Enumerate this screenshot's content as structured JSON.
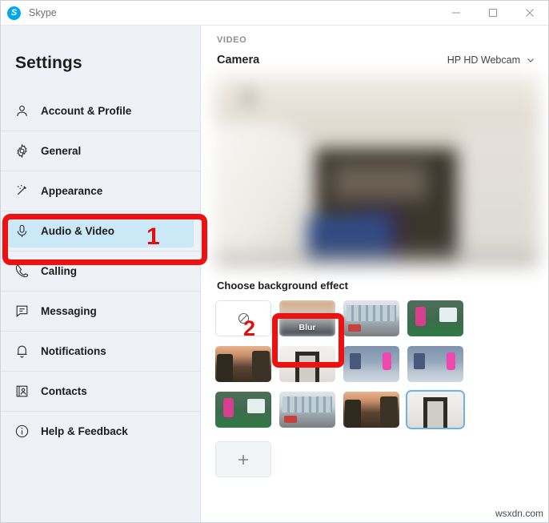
{
  "titlebar": {
    "app_name": "Skype",
    "logo_letter": "S",
    "minimize_label": "minimize-icon",
    "maximize_label": "maximize-icon",
    "close_label": "close-icon"
  },
  "sidebar": {
    "heading": "Settings",
    "items": [
      {
        "label": "Account & Profile",
        "icon": "person-icon",
        "selected": false
      },
      {
        "label": "General",
        "icon": "gear-icon",
        "selected": false
      },
      {
        "label": "Appearance",
        "icon": "magic-wand-icon",
        "selected": false
      },
      {
        "label": "Audio & Video",
        "icon": "microphone-icon",
        "selected": true
      },
      {
        "label": "Calling",
        "icon": "phone-icon",
        "selected": false
      },
      {
        "label": "Messaging",
        "icon": "chat-bubble-icon",
        "selected": false
      },
      {
        "label": "Notifications",
        "icon": "bell-icon",
        "selected": false
      },
      {
        "label": "Contacts",
        "icon": "contact-card-icon",
        "selected": false
      },
      {
        "label": "Help & Feedback",
        "icon": "info-circle-icon",
        "selected": false
      }
    ]
  },
  "annotations": {
    "step1": "1",
    "step2": "2",
    "accent_color": "#ee1111"
  },
  "main": {
    "section_label": "VIDEO",
    "camera_label": "Camera",
    "camera_device": "HP HD Webcam",
    "camera_chevron": "chevron-down-icon",
    "background_title": "Choose background effect",
    "blur_label": "Blur",
    "add_button_label": "+",
    "none_effect_icon": "no-effect-icon",
    "thumbnails": [
      {
        "name": "none-effect",
        "art": "none",
        "label": "",
        "selected": false
      },
      {
        "name": "blur-effect",
        "art": "t-blur",
        "label": "Blur",
        "selected": false
      },
      {
        "name": "background-office",
        "art": "t-office",
        "label": "",
        "selected": false
      },
      {
        "name": "background-gym",
        "art": "t-gym",
        "label": "",
        "selected": false
      },
      {
        "name": "background-forest",
        "art": "t-forest",
        "label": "",
        "selected": false
      },
      {
        "name": "background-door",
        "art": "t-door",
        "label": "",
        "selected": false
      },
      {
        "name": "background-store-1",
        "art": "t-store",
        "label": "",
        "selected": false
      },
      {
        "name": "background-store-2",
        "art": "t-store",
        "label": "",
        "selected": false
      },
      {
        "name": "background-gym-2",
        "art": "t-gym",
        "label": "",
        "selected": false
      },
      {
        "name": "background-office-2",
        "art": "t-office",
        "label": "",
        "selected": false
      },
      {
        "name": "background-forest-2",
        "art": "t-forest",
        "label": "",
        "selected": false
      },
      {
        "name": "background-door-2",
        "art": "t-door",
        "label": "",
        "selected": true
      }
    ]
  },
  "watermark": {
    "text": "wsxdn.com"
  },
  "colors": {
    "selected_nav_bg": "#cbe8f7",
    "sidebar_bg": "#eef1f5",
    "annotation_red": "#ee1111",
    "selection_blue": "#6fb3dd",
    "skype_blue": "#00a8e8"
  }
}
